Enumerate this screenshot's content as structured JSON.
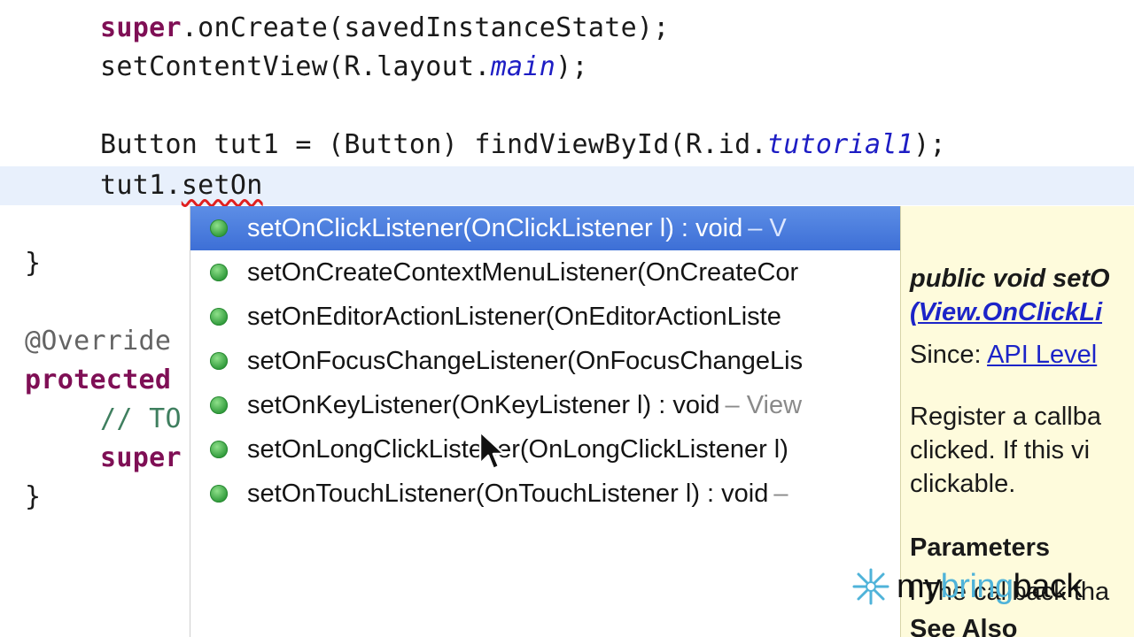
{
  "editor": {
    "lines": [
      {
        "indent": "    ",
        "parts": [
          {
            "t": "super",
            "c": "kw"
          },
          {
            "t": ".onCreate(savedInstanceState);",
            "c": ""
          }
        ]
      },
      {
        "indent": "    ",
        "parts": [
          {
            "t": "setContentView(R.layout.",
            "c": ""
          },
          {
            "t": "main",
            "c": "ital"
          },
          {
            "t": ");",
            "c": ""
          }
        ]
      },
      {
        "indent": "    ",
        "parts": [
          {
            "t": "Button tut1 = (Button) findViewById(R.id.",
            "c": ""
          },
          {
            "t": "tutorial1",
            "c": "ital"
          },
          {
            "t": ");",
            "c": ""
          }
        ]
      },
      {
        "indent": "    ",
        "parts": [
          {
            "t": "tut1.",
            "c": ""
          },
          {
            "t": "setOn",
            "c": "err"
          }
        ]
      },
      {
        "indent": "",
        "parts": [
          {
            "t": "}",
            "c": ""
          }
        ]
      },
      {
        "indent": "",
        "parts": [
          {
            "t": "@Override",
            "c": "ann"
          }
        ]
      },
      {
        "indent": "",
        "parts": [
          {
            "t": "protected",
            "c": "kw"
          }
        ]
      },
      {
        "indent": "    ",
        "parts": [
          {
            "t": "// TO",
            "c": "cmt"
          }
        ]
      },
      {
        "indent": "    ",
        "parts": [
          {
            "t": "super",
            "c": "kw"
          }
        ]
      },
      {
        "indent": "",
        "parts": [
          {
            "t": "}",
            "c": ""
          }
        ]
      }
    ]
  },
  "autocomplete": {
    "proposals": [
      {
        "signature": "setOnClickListener(OnClickListener l) : void",
        "origin": "– V",
        "selected": true
      },
      {
        "signature": "setOnCreateContextMenuListener(OnCreateCor",
        "origin": "",
        "selected": false
      },
      {
        "signature": "setOnEditorActionListener(OnEditorActionListe",
        "origin": "",
        "selected": false
      },
      {
        "signature": "setOnFocusChangeListener(OnFocusChangeLis",
        "origin": "",
        "selected": false
      },
      {
        "signature": "setOnKeyListener(OnKeyListener l) : void",
        "origin": "– View",
        "selected": false
      },
      {
        "signature": "setOnLongClickListener(OnLongClickListener l)",
        "origin": "",
        "selected": false
      },
      {
        "signature": "setOnTouchListener(OnTouchListener l) : void",
        "origin": "–",
        "selected": false
      }
    ]
  },
  "javadoc": {
    "signature": "public void setO",
    "param_link": "(View.OnClickLi",
    "since_label": "Since:",
    "since_link": "API Level",
    "description_lines": [
      "Register a callba",
      "clicked. If this vi",
      "clickable."
    ],
    "parameters_heading": "Parameters",
    "param_desc": "l The callback tha",
    "see_also": "See Also"
  },
  "watermark": {
    "part1": "my",
    "part2": "bring",
    "part3": "back"
  },
  "colors": {
    "selection": "#4a7ee0",
    "javadoc_bg": "#fefbdc",
    "keyword": "#7f0f55",
    "field_italic": "#1d1dc4",
    "current_line": "#e8f0fc",
    "link": "#1c24c8",
    "method_bullet": "#3aa644"
  },
  "icons": {
    "proposal_bullet": "public-method-icon",
    "cursor": "mouse-pointer-icon",
    "watermark_logo": "star-burst-icon"
  }
}
